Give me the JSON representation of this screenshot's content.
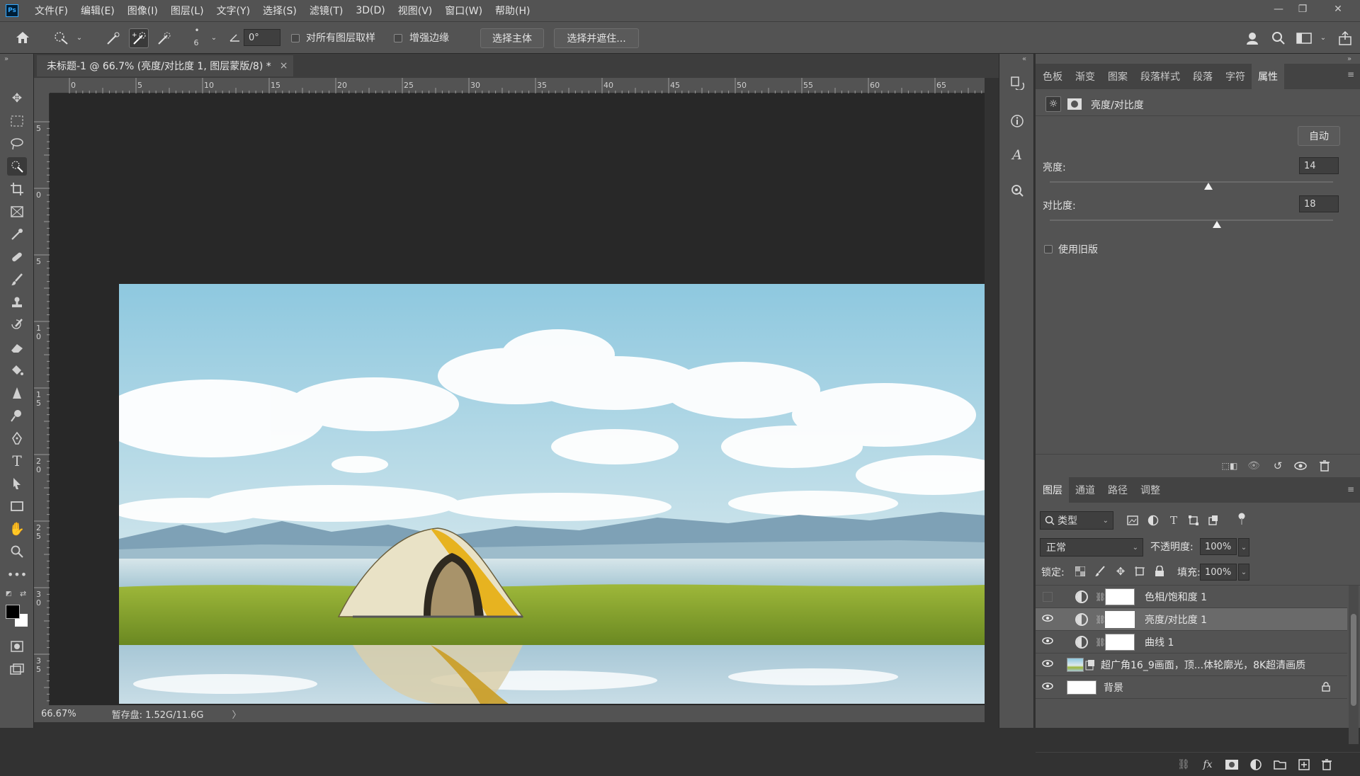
{
  "app": {
    "logo": "Ps"
  },
  "menu": [
    "文件(F)",
    "编辑(E)",
    "图像(I)",
    "图层(L)",
    "文字(Y)",
    "选择(S)",
    "滤镜(T)",
    "3D(D)",
    "视图(V)",
    "窗口(W)",
    "帮助(H)"
  ],
  "window_controls": {
    "minimize": "—",
    "restore": "❐",
    "close": "✕"
  },
  "options": {
    "brush_size": "6",
    "angle": "0°",
    "sample_all_layers": "对所有图层取样",
    "enhance_edge": "增强边缘",
    "select_subject": "选择主体",
    "select_and_mask": "选择并遮住..."
  },
  "document": {
    "tab_title": "未标题-1 @ 66.7% (亮度/对比度 1, 图层蒙版/8) *",
    "close": "×"
  },
  "ruler_h": [
    "0",
    "5",
    "10",
    "15",
    "20",
    "25",
    "30",
    "35",
    "40",
    "45",
    "50",
    "55",
    "60",
    "65"
  ],
  "ruler_v": [
    "5",
    "0",
    "5",
    "1\n0",
    "1\n5",
    "2\n0",
    "2\n5",
    "3\n0",
    "3\n5"
  ],
  "status": {
    "zoom": "66.67%",
    "scratch": "暂存盘: 1.52G/11.6G",
    "arrow": "〉"
  },
  "properties": {
    "tabs": [
      "色板",
      "渐变",
      "图案",
      "段落样式",
      "段落",
      "字符",
      "属性"
    ],
    "active_tab": "属性",
    "header": "亮度/对比度",
    "auto": "自动",
    "brightness_label": "亮度:",
    "brightness_value": "14",
    "brightness_level": 0.56,
    "contrast_label": "对比度:",
    "contrast_value": "18",
    "contrast_level": 0.59,
    "legacy": "使用旧版"
  },
  "layers_panel": {
    "tabs": [
      "图层",
      "通道",
      "路径",
      "调整"
    ],
    "active_tab": "图层",
    "filter": "类型",
    "blend_mode": "正常",
    "opacity_label": "不透明度:",
    "opacity": "100%",
    "lock_label": "锁定:",
    "fill_label": "填充:",
    "fill": "100%",
    "layers": [
      {
        "name": "色相/饱和度 1",
        "visible": false,
        "type": "adjustment"
      },
      {
        "name": "亮度/对比度 1",
        "visible": true,
        "type": "adjustment",
        "selected": true
      },
      {
        "name": "曲线 1",
        "visible": true,
        "type": "adjustment"
      },
      {
        "name": "超广角16_9画面，顶...体轮廓光，8K超清画质",
        "visible": true,
        "type": "image"
      },
      {
        "name": "背景",
        "visible": true,
        "type": "background"
      }
    ],
    "footer_fx": "fx"
  },
  "colors": {
    "accent": "#31a8ff",
    "panel": "#535353",
    "canvas": "#282828"
  }
}
